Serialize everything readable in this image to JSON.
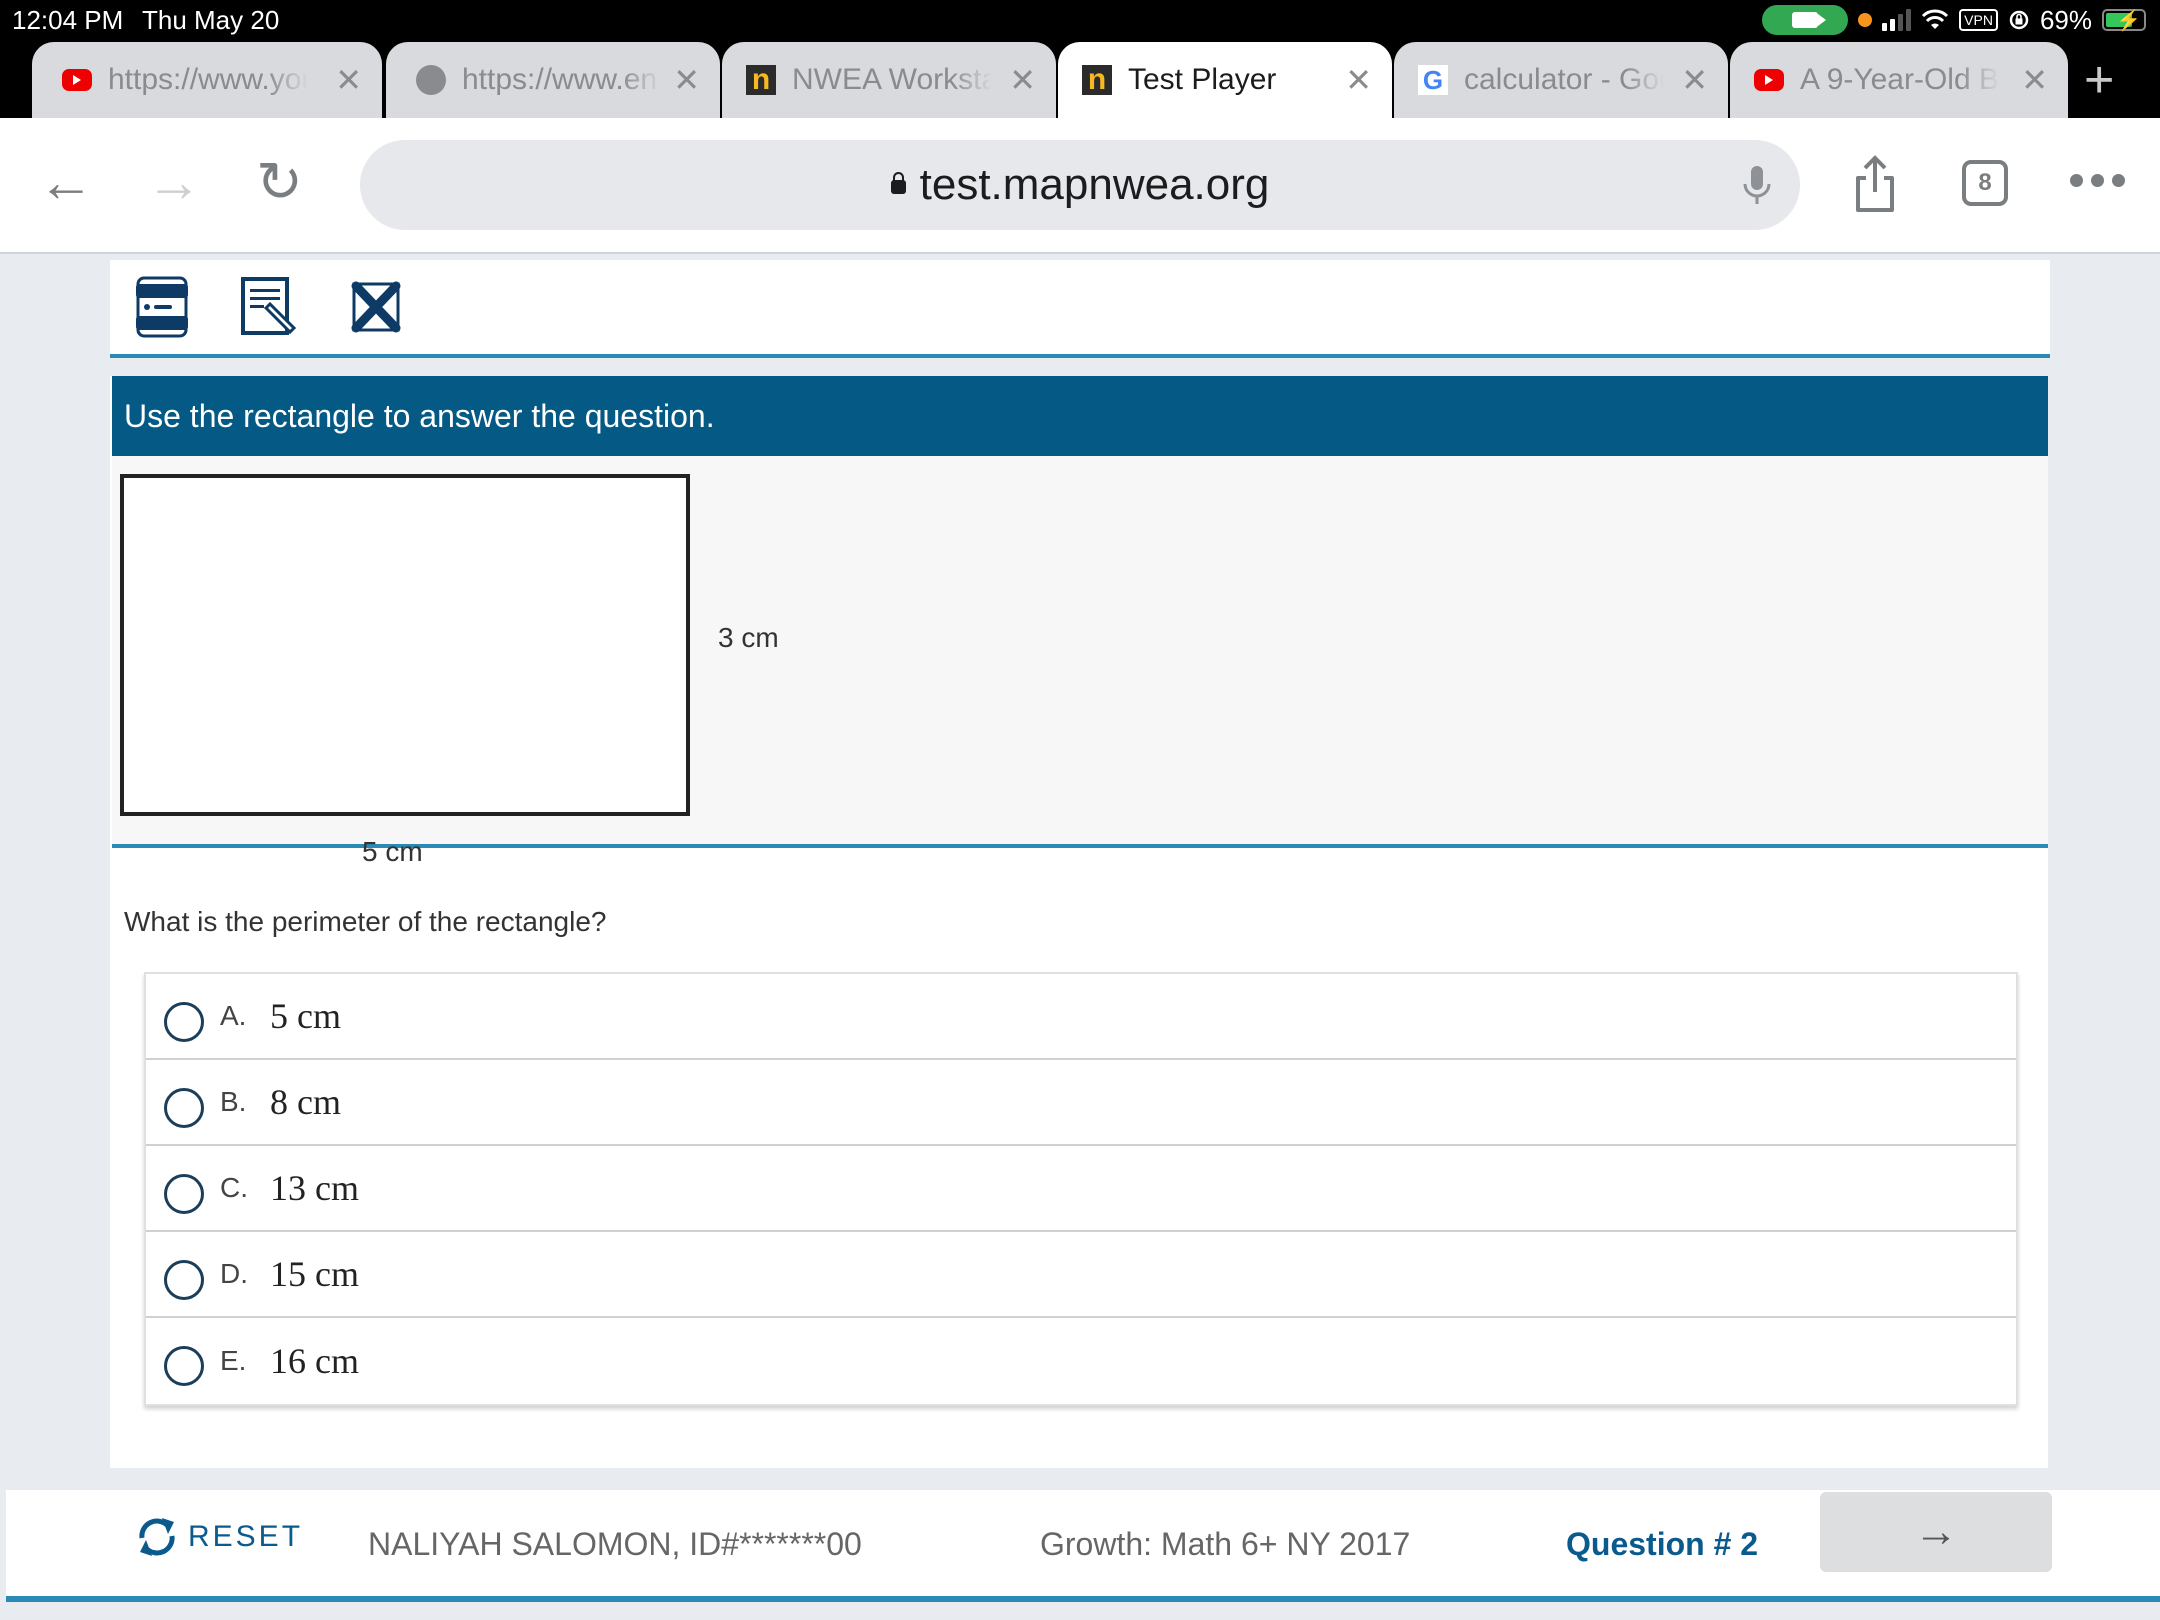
{
  "status_bar": {
    "time": "12:04 PM",
    "date": "Thu May 20",
    "battery_percent": "69%",
    "vpn_label": "VPN"
  },
  "tabs": [
    {
      "title": "https://www.youtube",
      "favicon": "youtube-icon",
      "active": false
    },
    {
      "title": "https://www.en",
      "favicon": "globe-icon",
      "active": false
    },
    {
      "title": "NWEA Workstation",
      "favicon": "nwea-icon",
      "active": false
    },
    {
      "title": "Test Player",
      "favicon": "nwea-icon",
      "active": true
    },
    {
      "title": "calculator - Google",
      "favicon": "google-icon",
      "active": false
    },
    {
      "title": "A 9-Year-Old B",
      "favicon": "youtube-icon",
      "active": false
    }
  ],
  "tab_close_glyph": "✕",
  "new_tab_glyph": "+",
  "browser": {
    "url": "test.mapnwea.org",
    "tab_count": "8",
    "back_glyph": "←",
    "forward_glyph": "→",
    "reload_glyph": "↻"
  },
  "test_tools": [
    "answer-masking-icon",
    "notepad-icon",
    "close-test-icon"
  ],
  "item": {
    "instruction": "Use the rectangle to answer the question.",
    "figure": {
      "shape": "rectangle",
      "width_label": "5 cm",
      "height_label": "3 cm"
    },
    "question": "What is the perimeter of the rectangle?",
    "choices": [
      {
        "letter": "A.",
        "value": "5 cm",
        "selected": false
      },
      {
        "letter": "B.",
        "value": "8 cm",
        "selected": false
      },
      {
        "letter": "C.",
        "value": "13 cm",
        "selected": false
      },
      {
        "letter": "D.",
        "value": "15 cm",
        "selected": false
      },
      {
        "letter": "E.",
        "value": "16 cm",
        "selected": false
      }
    ]
  },
  "footer": {
    "reset_label": "RESET",
    "student": "NALIYAH SALOMON, ID#*******00",
    "test_name": "Growth: Math 6+ NY 2017",
    "question_number": "Question # 2",
    "next_glyph": "→"
  },
  "colors": {
    "brand_dark_blue": "#055a85",
    "accent_blue": "#2a8ab5",
    "link_blue": "#0b5a8e"
  }
}
